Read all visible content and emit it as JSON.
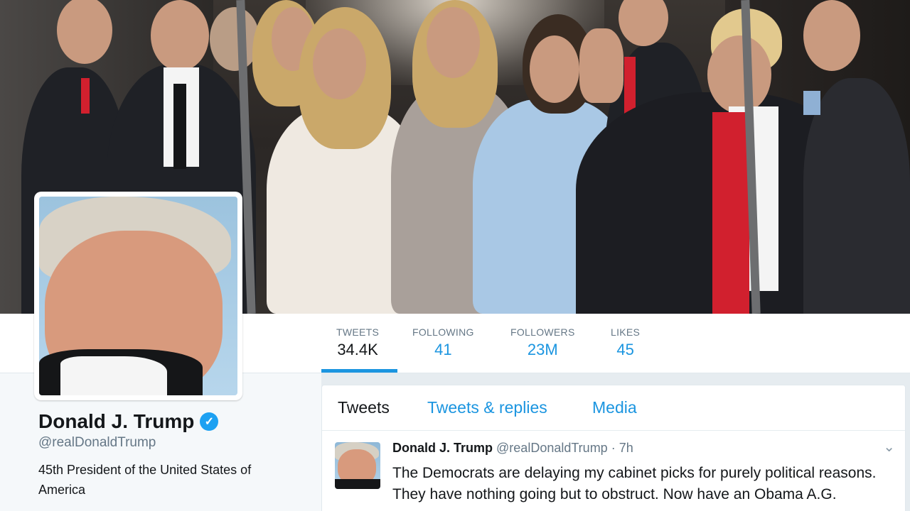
{
  "profile": {
    "name": "Donald J. Trump",
    "handle": "@realDonaldTrump",
    "bio": "45th President of the United States of America",
    "verified_icon": "verified-checkmark-icon"
  },
  "stats": [
    {
      "label": "TWEETS",
      "value": "34.4K"
    },
    {
      "label": "FOLLOWING",
      "value": "41"
    },
    {
      "label": "FOLLOWERS",
      "value": "23M"
    },
    {
      "label": "LIKES",
      "value": "45"
    }
  ],
  "timeline": {
    "tabs": [
      "Tweets",
      "Tweets & replies",
      "Media"
    ],
    "tweet": {
      "name": "Donald J. Trump",
      "handle": "@realDonaldTrump",
      "separator": " · ",
      "time": "7h",
      "text": "The Democrats are delaying my cabinet picks for purely political reasons. They have nothing going but to obstruct. Now have an Obama A.G."
    }
  },
  "colors": {
    "accent": "#1b95e0",
    "verified": "#1da1f2",
    "background": "#e6ecf0"
  }
}
